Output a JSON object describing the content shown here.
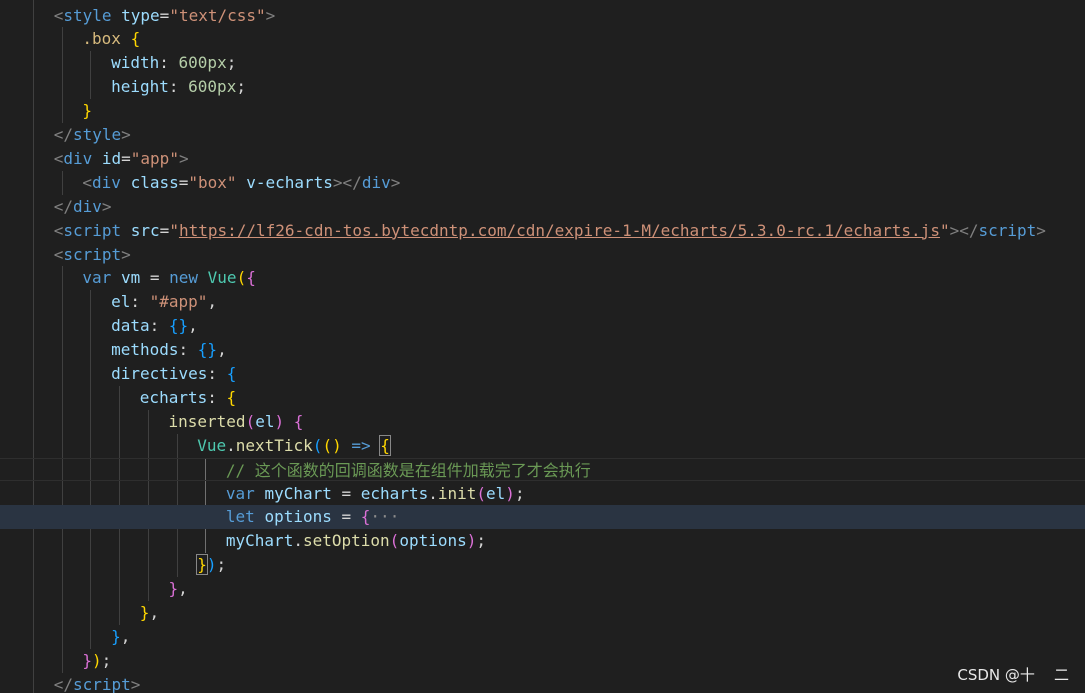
{
  "editor": {
    "language": "html",
    "highlighted_line": 21,
    "lines": [
      {
        "indent": 1,
        "tokens": [
          [
            "pu",
            "<"
          ],
          [
            "tg",
            "style"
          ],
          [
            "tx",
            " "
          ],
          [
            "at",
            "type"
          ],
          [
            "tx",
            "="
          ],
          [
            "st",
            "\"text/css\""
          ],
          [
            "pu",
            ">"
          ]
        ]
      },
      {
        "indent": 2,
        "tokens": [
          [
            "sel",
            ".box"
          ],
          [
            "tx",
            " "
          ],
          [
            "b1",
            "{"
          ]
        ]
      },
      {
        "indent": 3,
        "tokens": [
          [
            "vr",
            "width"
          ],
          [
            "tx",
            ": "
          ],
          [
            "nm",
            "600px"
          ],
          [
            "tx",
            ";"
          ]
        ]
      },
      {
        "indent": 3,
        "tokens": [
          [
            "vr",
            "height"
          ],
          [
            "tx",
            ": "
          ],
          [
            "nm",
            "600px"
          ],
          [
            "tx",
            ";"
          ]
        ]
      },
      {
        "indent": 2,
        "tokens": [
          [
            "b1",
            "}"
          ]
        ]
      },
      {
        "indent": 1,
        "tokens": [
          [
            "pu",
            "</"
          ],
          [
            "tg",
            "style"
          ],
          [
            "pu",
            ">"
          ]
        ]
      },
      {
        "indent": 1,
        "tokens": [
          [
            "pu",
            "<"
          ],
          [
            "tg",
            "div"
          ],
          [
            "tx",
            " "
          ],
          [
            "at",
            "id"
          ],
          [
            "tx",
            "="
          ],
          [
            "st",
            "\"app\""
          ],
          [
            "pu",
            ">"
          ]
        ]
      },
      {
        "indent": 2,
        "tokens": [
          [
            "pu",
            "<"
          ],
          [
            "tg",
            "div"
          ],
          [
            "tx",
            " "
          ],
          [
            "at",
            "class"
          ],
          [
            "tx",
            "="
          ],
          [
            "st",
            "\"box\""
          ],
          [
            "tx",
            " "
          ],
          [
            "at",
            "v-echarts"
          ],
          [
            "pu",
            "></"
          ],
          [
            "tg",
            "div"
          ],
          [
            "pu",
            ">"
          ]
        ]
      },
      {
        "indent": 1,
        "tokens": [
          [
            "pu",
            "</"
          ],
          [
            "tg",
            "div"
          ],
          [
            "pu",
            ">"
          ]
        ]
      },
      {
        "indent": 1,
        "tokens": [
          [
            "pu",
            "<"
          ],
          [
            "tg",
            "script"
          ],
          [
            "tx",
            " "
          ],
          [
            "at",
            "src"
          ],
          [
            "tx",
            "="
          ],
          [
            "st",
            "\""
          ],
          [
            "url",
            "https://lf26-cdn-tos.bytecdntp.com/cdn/expire-1-M/echarts/5.3.0-rc.1/echarts.js"
          ],
          [
            "st",
            "\""
          ],
          [
            "pu",
            "></"
          ],
          [
            "tg",
            "script"
          ],
          [
            "pu",
            ">"
          ]
        ]
      },
      {
        "indent": 1,
        "tokens": [
          [
            "pu",
            "<"
          ],
          [
            "tg",
            "script"
          ],
          [
            "pu",
            ">"
          ]
        ]
      },
      {
        "indent": 2,
        "tokens": [
          [
            "kw",
            "var"
          ],
          [
            "tx",
            " "
          ],
          [
            "vr",
            "vm"
          ],
          [
            "tx",
            " = "
          ],
          [
            "kw",
            "new"
          ],
          [
            "tx",
            " "
          ],
          [
            "cl",
            "Vue"
          ],
          [
            "b1",
            "("
          ],
          [
            "b2",
            "{"
          ]
        ]
      },
      {
        "indent": 3,
        "tokens": [
          [
            "vr",
            "el"
          ],
          [
            "tx",
            ": "
          ],
          [
            "st",
            "\"#app\""
          ],
          [
            "tx",
            ","
          ]
        ]
      },
      {
        "indent": 3,
        "tokens": [
          [
            "vr",
            "data"
          ],
          [
            "tx",
            ": "
          ],
          [
            "b3",
            "{}"
          ],
          [
            "tx",
            ","
          ]
        ]
      },
      {
        "indent": 3,
        "tokens": [
          [
            "vr",
            "methods"
          ],
          [
            "tx",
            ": "
          ],
          [
            "b3",
            "{}"
          ],
          [
            "tx",
            ","
          ]
        ]
      },
      {
        "indent": 3,
        "tokens": [
          [
            "vr",
            "directives"
          ],
          [
            "tx",
            ": "
          ],
          [
            "b3",
            "{"
          ]
        ]
      },
      {
        "indent": 4,
        "tokens": [
          [
            "vr",
            "echarts"
          ],
          [
            "tx",
            ": "
          ],
          [
            "b1",
            "{"
          ]
        ]
      },
      {
        "indent": 5,
        "tokens": [
          [
            "fn",
            "inserted"
          ],
          [
            "b2",
            "("
          ],
          [
            "vr",
            "el"
          ],
          [
            "b2",
            ")"
          ],
          [
            "tx",
            " "
          ],
          [
            "b2",
            "{"
          ]
        ]
      },
      {
        "indent": 6,
        "tokens": [
          [
            "cl",
            "Vue"
          ],
          [
            "tx",
            "."
          ],
          [
            "fn",
            "nextTick"
          ],
          [
            "b3",
            "("
          ],
          [
            "b1",
            "()"
          ],
          [
            "tx",
            " "
          ],
          [
            "kw",
            "=>"
          ],
          [
            "tx",
            " "
          ],
          [
            "b1match",
            "{"
          ]
        ]
      },
      {
        "indent": 7,
        "tokens": [
          [
            "cm",
            "// 这个函数的回调函数是在组件加载完了才会执行"
          ]
        ]
      },
      {
        "indent": 7,
        "tokens": [
          [
            "kw",
            "var"
          ],
          [
            "tx",
            " "
          ],
          [
            "vr",
            "myChart"
          ],
          [
            "tx",
            " = "
          ],
          [
            "vr",
            "echarts"
          ],
          [
            "tx",
            "."
          ],
          [
            "fn",
            "init"
          ],
          [
            "b2",
            "("
          ],
          [
            "vr",
            "el"
          ],
          [
            "b2",
            ")"
          ],
          [
            "tx",
            ";"
          ]
        ]
      },
      {
        "indent": 7,
        "tokens": [
          [
            "kw",
            "let"
          ],
          [
            "tx",
            " "
          ],
          [
            "vr",
            "options"
          ],
          [
            "tx",
            " = "
          ],
          [
            "b2",
            "{"
          ],
          [
            "fold",
            "···"
          ]
        ]
      },
      {
        "indent": 7,
        "tokens": [
          [
            "vr",
            "myChart"
          ],
          [
            "tx",
            "."
          ],
          [
            "fn",
            "setOption"
          ],
          [
            "b2",
            "("
          ],
          [
            "vr",
            "options"
          ],
          [
            "b2",
            ")"
          ],
          [
            "tx",
            ";"
          ]
        ]
      },
      {
        "indent": 6,
        "tokens": [
          [
            "b1match",
            "}"
          ],
          [
            "b3",
            ")"
          ],
          [
            "tx",
            ";"
          ]
        ]
      },
      {
        "indent": 5,
        "tokens": [
          [
            "b2",
            "}"
          ],
          [
            "tx",
            ","
          ]
        ]
      },
      {
        "indent": 4,
        "tokens": [
          [
            "b1",
            "}"
          ],
          [
            "tx",
            ","
          ]
        ]
      },
      {
        "indent": 3,
        "tokens": [
          [
            "b3",
            "}"
          ],
          [
            "tx",
            ","
          ]
        ]
      },
      {
        "indent": 2,
        "tokens": [
          [
            "b2",
            "}"
          ],
          [
            "b1",
            ")"
          ],
          [
            "tx",
            ";"
          ]
        ]
      },
      {
        "indent": 1,
        "tokens": [
          [
            "pu",
            "</"
          ],
          [
            "tg",
            "script"
          ],
          [
            "pu",
            ">"
          ]
        ]
      }
    ]
  },
  "watermark": "CSDN @十    二"
}
